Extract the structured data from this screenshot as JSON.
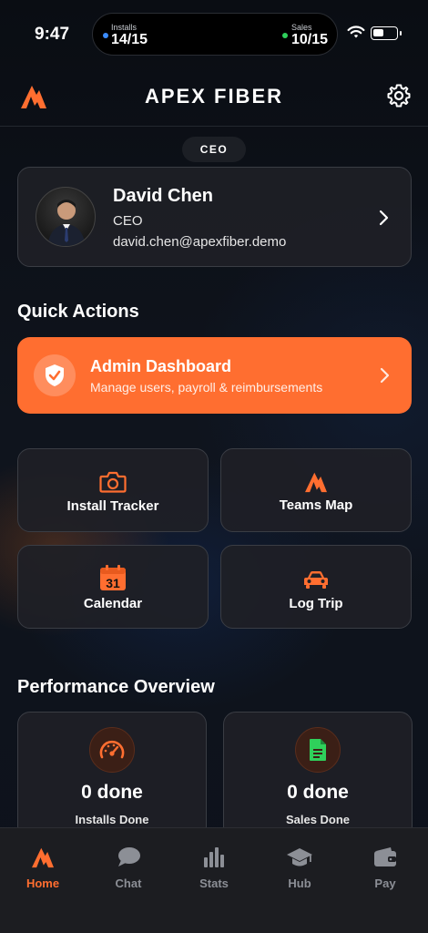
{
  "status_bar": {
    "time": "9:47",
    "installs_label": "Installs",
    "installs_value": "14/15",
    "sales_label": "Sales",
    "sales_value": "10/15"
  },
  "header": {
    "title": "APEX FIBER",
    "role_badge": "CEO"
  },
  "profile": {
    "name": "David Chen",
    "role": "CEO",
    "email": "david.chen@apexfiber.demo"
  },
  "quick_actions": {
    "title": "Quick Actions",
    "admin": {
      "title": "Admin Dashboard",
      "subtitle": "Manage users, payroll & reimbursements"
    },
    "tiles": [
      {
        "label": "Install Tracker",
        "icon": "camera-icon"
      },
      {
        "label": "Teams Map",
        "icon": "apex-logo-icon"
      },
      {
        "label": "Calendar",
        "icon": "calendar-icon",
        "badge": "31"
      },
      {
        "label": "Log Trip",
        "icon": "car-icon"
      }
    ]
  },
  "performance": {
    "title": "Performance Overview",
    "cards": [
      {
        "value": "0 done",
        "label": "Installs Done",
        "icon": "speedometer-icon"
      },
      {
        "value": "0 done",
        "label": "Sales Done",
        "icon": "document-icon"
      }
    ]
  },
  "tabs": [
    {
      "label": "Home",
      "icon": "home-logo-icon",
      "active": true
    },
    {
      "label": "Chat",
      "icon": "chat-icon"
    },
    {
      "label": "Stats",
      "icon": "stats-icon"
    },
    {
      "label": "Hub",
      "icon": "graduation-cap-icon"
    },
    {
      "label": "Pay",
      "icon": "wallet-icon"
    }
  ],
  "colors": {
    "accent": "#ff6e30",
    "installs_dot": "#3b8cff",
    "sales_dot": "#2fd05b",
    "document_icon": "#2fd05b"
  }
}
